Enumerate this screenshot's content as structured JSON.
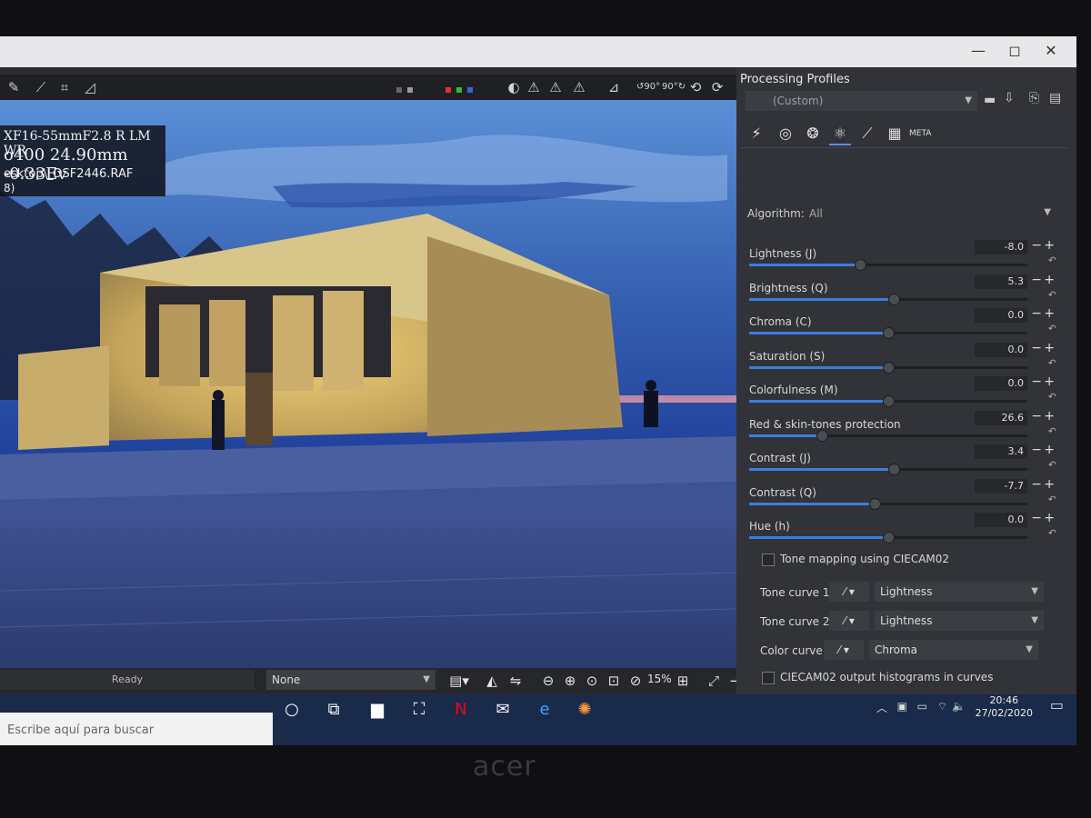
{
  "window": {
    "minimize": "—",
    "maximize": "◻",
    "close": "✕"
  },
  "toolbar": {
    "rotate_labels": [
      "90°",
      "90°"
    ]
  },
  "image_info": {
    "lens": "XF16-55mmF2.8 R LM WR",
    "exposure": "o400  24.90mm  -0.33Ev",
    "path": "esktop\\_DSF2446.RAF",
    "extra": "8)"
  },
  "bottombar": {
    "status": "Ready",
    "output_profile": "None",
    "zoom": "15%"
  },
  "panel": {
    "title": "Processing Profiles",
    "profile": "(Custom)",
    "algorithm_label": "Algorithm:",
    "algorithm_value": "All",
    "sliders": [
      {
        "label": "Lightness (J)",
        "value": "-8.0",
        "pos": 0.4
      },
      {
        "label": "Brightness (Q)",
        "value": "5.3",
        "pos": 0.52
      },
      {
        "label": "Chroma (C)",
        "value": "0.0",
        "pos": 0.5
      },
      {
        "label": "Saturation (S)",
        "value": "0.0",
        "pos": 0.5
      },
      {
        "label": "Colorfulness (M)",
        "value": "0.0",
        "pos": 0.5
      },
      {
        "label": "Red & skin-tones protection",
        "value": "26.6",
        "pos": 0.26
      },
      {
        "label": "Contrast (J)",
        "value": "3.4",
        "pos": 0.52
      },
      {
        "label": "Contrast (Q)",
        "value": "-7.7",
        "pos": 0.45
      },
      {
        "label": "Hue (h)",
        "value": "0.0",
        "pos": 0.5
      }
    ],
    "tone_mapping": "Tone mapping using CIECAM02",
    "curves": [
      {
        "label": "Tone curve 1:",
        "value": "Lightness"
      },
      {
        "label": "Tone curve 2:",
        "value": "Lightness"
      },
      {
        "label": "Color curve:",
        "value": "Chroma"
      }
    ],
    "histograms": "CIECAM02 output histograms in curves"
  },
  "taskbar": {
    "search_placeholder": "Escribe aquí para buscar",
    "time": "20:46",
    "date": "27/02/2020"
  },
  "bezel": {
    "brand": "acer"
  }
}
